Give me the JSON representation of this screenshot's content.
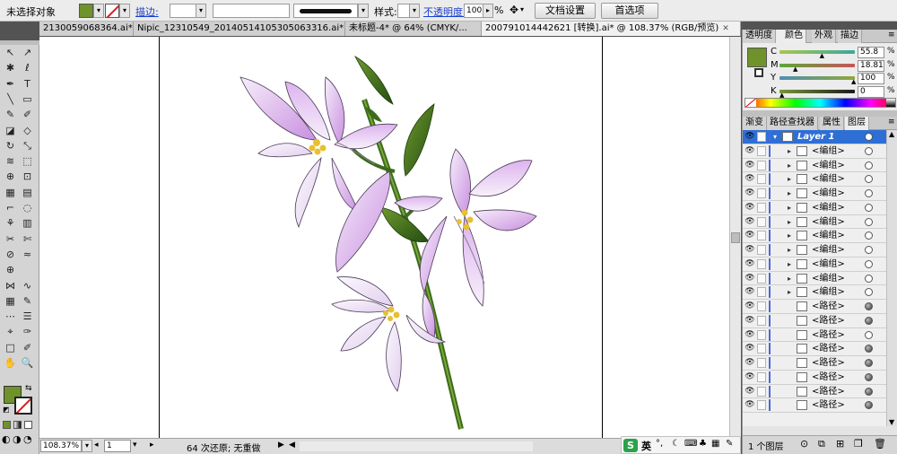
{
  "control_bar": {
    "selection_label": "未选择对象",
    "stroke_label": "描边:",
    "style_label": "样式:",
    "opacity_label": "不透明度:",
    "opacity_value": "100",
    "opacity_unit": "%",
    "doc_setup_button": "文档设置",
    "prefs_button": "首选项"
  },
  "tabs": [
    {
      "label": "2130059068364.ai*",
      "active": false
    },
    {
      "label": "Nipic_12310549_20140514105305063316.ai*",
      "active": false
    },
    {
      "label": "未标题-4* @ 64% (CMYK/...",
      "active": false
    },
    {
      "label": "2007910144426​21 [转换].ai* @ 108.37% (RGB/预览)",
      "active": true
    }
  ],
  "status_bar": {
    "zoom": "108.37%",
    "page": "1",
    "undo_text": "64 次还原; 无重做"
  },
  "ime": {
    "lang": "英"
  },
  "color_panel": {
    "tabs": [
      {
        "label": "透明度",
        "active": false
      },
      {
        "label": "颜色",
        "active": true
      },
      {
        "label": "外观",
        "active": false
      },
      {
        "label": "描边",
        "active": false
      }
    ],
    "fill_color": "#70922a",
    "channels": [
      {
        "name": "C",
        "value": "55.8",
        "level": 0.558,
        "gradient": "linear-gradient(90deg,#a8c84a,#3aa7a0)"
      },
      {
        "name": "M",
        "value": "18.81",
        "level": 0.188,
        "gradient": "linear-gradient(90deg,#5aa83a,#c8545a)"
      },
      {
        "name": "Y",
        "value": "100",
        "level": 1.0,
        "gradient": "linear-gradient(90deg,#4f8fb0,#8fa83a)"
      },
      {
        "name": "K",
        "value": "0",
        "level": 0.0,
        "gradient": "linear-gradient(90deg,#78963a,#1a1a1a)"
      }
    ]
  },
  "layers_panel": {
    "tabs": [
      {
        "label": "渐变",
        "active": false
      },
      {
        "label": "路径查找器",
        "active": false
      },
      {
        "label": "属性",
        "active": false
      },
      {
        "label": "图层",
        "active": true
      }
    ],
    "rows": [
      {
        "label": "Layer 1",
        "kind": "layer",
        "selected": true
      },
      {
        "label": "<编组>",
        "kind": "group"
      },
      {
        "label": "<编组>",
        "kind": "group"
      },
      {
        "label": "<编组>",
        "kind": "group"
      },
      {
        "label": "<编组>",
        "kind": "group"
      },
      {
        "label": "<编组>",
        "kind": "group"
      },
      {
        "label": "<编组>",
        "kind": "group"
      },
      {
        "label": "<编组>",
        "kind": "group"
      },
      {
        "label": "<编组>",
        "kind": "group"
      },
      {
        "label": "<编组>",
        "kind": "group"
      },
      {
        "label": "<编组>",
        "kind": "group"
      },
      {
        "label": "<编组>",
        "kind": "group"
      },
      {
        "label": "<路径>",
        "kind": "path",
        "filled": true
      },
      {
        "label": "<路径>",
        "kind": "path",
        "filled": true
      },
      {
        "label": "<路径>",
        "kind": "path",
        "filled": false
      },
      {
        "label": "<路径>",
        "kind": "path",
        "filled": true
      },
      {
        "label": "<路径>",
        "kind": "path",
        "filled": true
      },
      {
        "label": "<路径>",
        "kind": "path",
        "filled": true
      },
      {
        "label": "<路径>",
        "kind": "path",
        "filled": true
      },
      {
        "label": "<路径>",
        "kind": "path",
        "filled": true
      }
    ],
    "layer_count": "1 个图层"
  }
}
